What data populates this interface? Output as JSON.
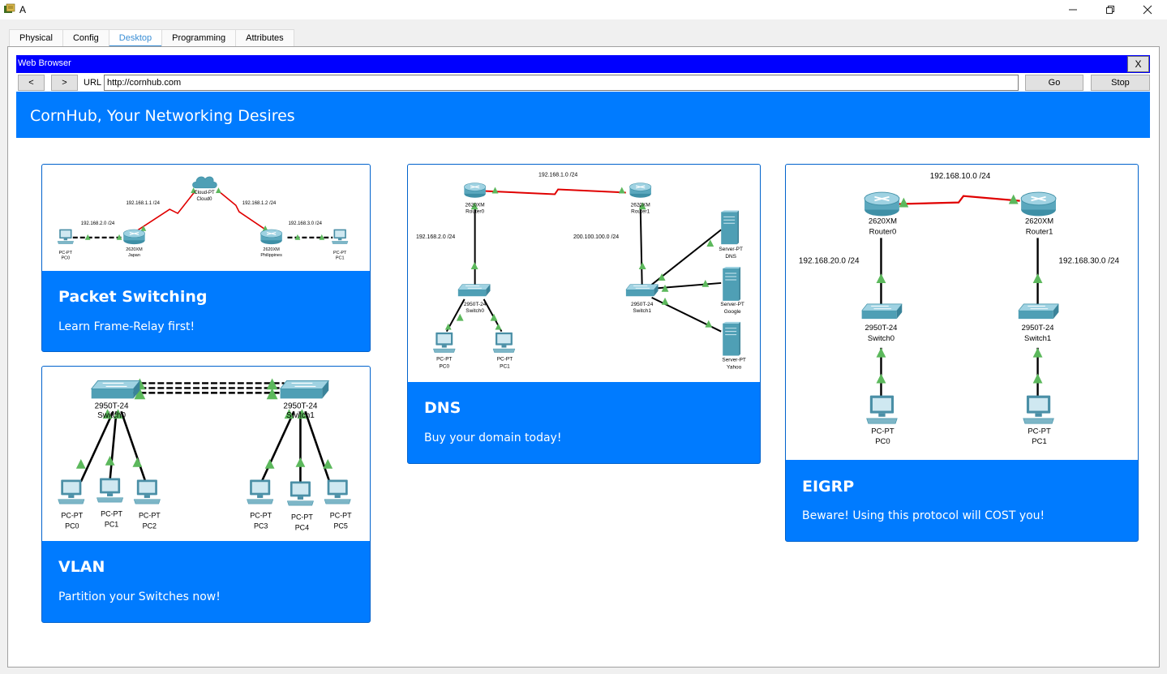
{
  "window": {
    "title": "A",
    "minimize": "—",
    "maximize": "❐",
    "close": "✕"
  },
  "tabs": [
    {
      "label": "Physical"
    },
    {
      "label": "Config"
    },
    {
      "label": "Desktop"
    },
    {
      "label": "Programming"
    },
    {
      "label": "Attributes"
    }
  ],
  "browser": {
    "title": "Web Browser",
    "close": "X",
    "back": "<",
    "forward": ">",
    "url_label": "URL",
    "url": "http://cornhub.com",
    "go": "Go",
    "stop": "Stop"
  },
  "page": {
    "title": "CornHub, Your Networking Desires"
  },
  "cards": [
    {
      "title": "Packet Switching",
      "text": "Learn Frame-Relay first!",
      "diagram": {
        "cloud": "Cloud-PT",
        "cloud_name": "Cloud0",
        "net_left": "192.168.1.1 /24",
        "net_right": "192.168.1.2 /24",
        "lan_left": "192.168.2.0 /24",
        "lan_right": "192.168.3.0 /24",
        "router_model": "2620XM",
        "router_left": "Japan",
        "router_right": "Philippines",
        "pc_model": "PC-PT",
        "pc_left": "PC0",
        "pc_right": "PC1"
      }
    },
    {
      "title": "VLAN",
      "text": "Partition your Switches now!",
      "diagram": {
        "switch_model": "2950T-24",
        "switch_left": "Switch0",
        "switch_right": "Switch1",
        "pc_model": "PC-PT",
        "pcs": [
          "PC0",
          "PC1",
          "PC2",
          "PC3",
          "PC4",
          "PC5"
        ]
      }
    },
    {
      "title": "DNS",
      "text": "Buy your domain today!",
      "diagram": {
        "wan": "192.168.1.0 /24",
        "lan_left": "192.168.2.0 /24",
        "lan_right": "200.100.100.0 /24",
        "router_model": "2620XM",
        "router_left": "Router0",
        "router_right": "Router1",
        "switch_model": "2950T-24",
        "switch_left": "Switch0",
        "switch_right": "Switch1",
        "pc_model": "PC-PT",
        "pc_left": "PC0",
        "pc_right": "PC1",
        "server_model": "Server-PT",
        "servers": [
          "DNS",
          "Google",
          "Yahoo"
        ]
      }
    },
    {
      "title": "EIGRP",
      "text": "Beware! Using this protocol will COST you!",
      "diagram": {
        "wan": "192.168.10.0 /24",
        "lan_left": "192.168.20.0 /24",
        "lan_right": "192.168.30.0 /24",
        "router_model": "2620XM",
        "router_left": "Router0",
        "router_right": "Router1",
        "switch_model": "2950T-24",
        "switch_left": "Switch0",
        "switch_right": "Switch1",
        "pc_model": "PC-PT",
        "pc_left": "PC0",
        "pc_right": "PC1"
      }
    }
  ],
  "colors": {
    "accent": "#007bff",
    "browser_bar": "#0000ff",
    "link_red": "#e00000",
    "link_up": "#5cb85c"
  }
}
